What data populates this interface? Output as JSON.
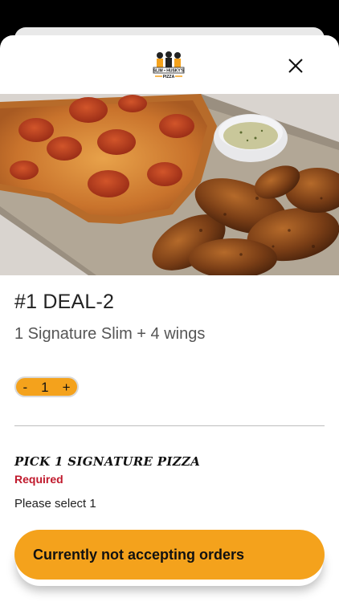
{
  "brand": {
    "logo_icon": "slim-and-huskys-pizza-logo",
    "logo_text": "SLIM & HUSKY'S PIZZA",
    "accent_color": "#f4a21c"
  },
  "header": {
    "close_icon": "close-icon"
  },
  "item": {
    "title": "#1 DEAL-2",
    "description": "1 Signature Slim + 4 wings",
    "quantity": "1",
    "decrement_label": "-",
    "increment_label": "+"
  },
  "options": {
    "section_title": "Pick 1 Signature Pizza",
    "required_label": "Required",
    "hint": "Please select 1",
    "required_color": "#c0192c"
  },
  "cta": {
    "label": "Currently not accepting orders"
  }
}
